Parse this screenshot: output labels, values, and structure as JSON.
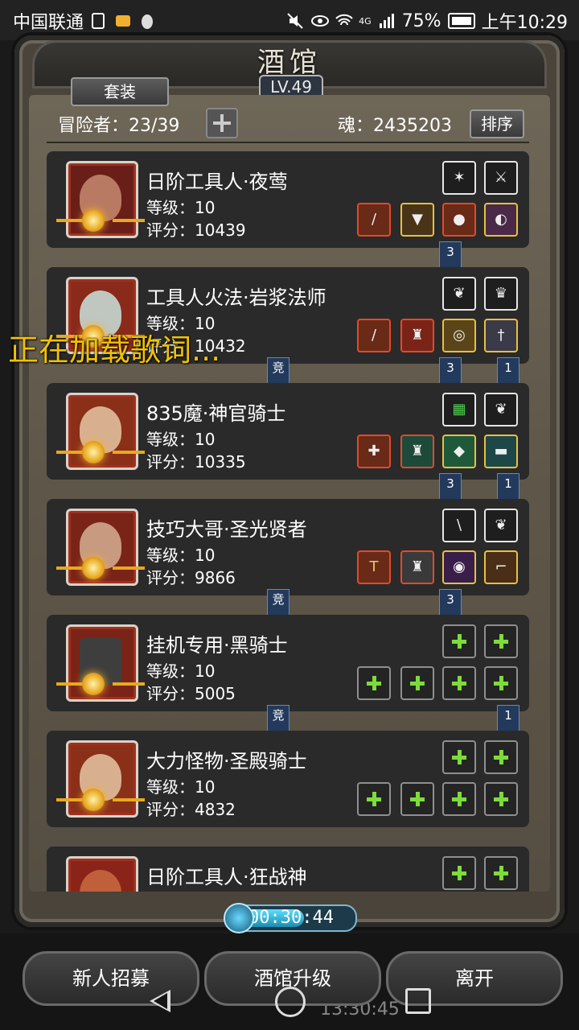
{
  "status_bar": {
    "carrier": "中国联通",
    "battery": "75%",
    "network": "4G",
    "time": "上午10:29"
  },
  "header": {
    "title": "酒馆",
    "level": "LV.49",
    "suit_button": "套装",
    "adventurers_label": "冒险者：23/39",
    "soul_label": "魂：2435203",
    "sort_button": "排序"
  },
  "heroes": [
    {
      "name": "日阶工具人·夜莺",
      "level": "等级：10",
      "score": "评分：10439",
      "tag_left": "",
      "tag_mid": "3",
      "tag_right": ""
    },
    {
      "name": "工具人火法·岩浆法师",
      "level": "等级：10",
      "score": "评分：10432",
      "tag_left": "竞",
      "tag_mid": "3",
      "tag_right": "1"
    },
    {
      "name": "835魔·神官骑士",
      "level": "等级：10",
      "score": "评分：10335",
      "tag_left": "",
      "tag_mid": "3",
      "tag_right": "1"
    },
    {
      "name": "技巧大哥·圣光贤者",
      "level": "等级：10",
      "score": "评分：9866",
      "tag_left": "竞",
      "tag_mid": "3",
      "tag_right": ""
    },
    {
      "name": "挂机专用·黑骑士",
      "level": "等级：10",
      "score": "评分：5005",
      "tag_left": "竞",
      "tag_mid": "",
      "tag_right": "1"
    },
    {
      "name": "大力怪物·圣殿骑士",
      "level": "等级：10",
      "score": "评分：4832",
      "tag_left": "",
      "tag_mid": "",
      "tag_right": ""
    },
    {
      "name": "日阶工具人·狂战神",
      "level": "",
      "score": "",
      "tag_left": "",
      "tag_mid": "",
      "tag_right": ""
    }
  ],
  "overlay": {
    "lyric": "正在加载歌词..."
  },
  "timer": {
    "value": "00:30:44"
  },
  "bottom_buttons": {
    "recruit": "新人招募",
    "upgrade": "酒馆升级",
    "leave": "离开"
  },
  "background_time": "13:30:45",
  "colors": {
    "accent_gold": "#e8a820",
    "tag_blue": "#233a5c",
    "lyric_yellow": "#f2c200"
  }
}
